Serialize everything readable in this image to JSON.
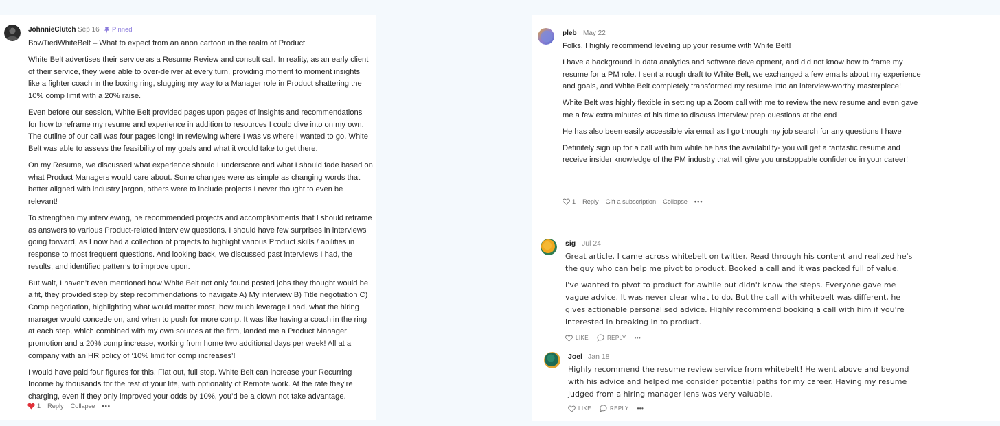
{
  "comments": {
    "johnnie": {
      "author": "JohnnieClutch",
      "date": "Sep 16",
      "pinned_label": "Pinned",
      "paragraphs": [
        "BowTiedWhiteBelt – What to expect from an anon cartoon in the realm of Product",
        "White Belt advertises their service as a Resume Review and consult call. In reality, as an early client of their service, they were able to over-deliver at every turn, providing moment to moment insights like a fighter coach in the boxing ring, slugging my way to a Manager role in Product shattering the 10% comp limit with a 20% raise.",
        "Even before our session, White Belt provided pages upon pages of insights and recommendations for how to reframe my resume and experience in addition to resources I could dive into on my own. The outline of our call was four pages long! In reviewing where I was vs where I wanted to go, White Belt was able to assess the feasibility of my goals and what it would take to get there.",
        "On my Resume, we discussed what experience should I underscore and what I should fade based on what Product Managers would care about. Some changes were as simple as changing words that better aligned with industry jargon, others were to include projects I never thought to even be relevant!",
        "To strengthen my interviewing, he recommended projects and accomplishments that I should reframe as answers to various Product-related interview questions. I should have few surprises in interviews going forward, as I now had a collection of projects to highlight various Product skills / abilities in response to most frequent questions. And looking back, we discussed past interviews I had, the results, and identified patterns to improve upon.",
        "But wait, I haven’t even mentioned how White Belt not only found posted jobs they thought would be a fit, they provided step by step recommendations to navigate A) My interview B) Title negotiation C) Comp negotiation, highlighting what would matter most, how much leverage I had, what the hiring manager would concede on, and when to push for more comp. It was like having a coach in the ring at each step, which combined with my own sources at the firm, landed me a Product Manager promotion and a 20% comp increase, working from home two additional days per week! All at a company with an HR policy of ‘10% limit for comp increases’!",
        "I would have paid four figures for this. Flat out, full stop. White Belt can increase your Recurring Income by thousands for the rest of your life, with optionality of Remote work. At the rate they’re charging, even if they only improved your odds by 10%, you’d be a clown not take advantage."
      ],
      "like_count": "1",
      "reply_label": "Reply",
      "collapse_label": "Collapse",
      "more": "•••"
    },
    "pleb": {
      "author": "pleb",
      "date": "May 22",
      "paragraphs": [
        "Folks, I highly recommend leveling up your resume with White Belt!",
        "I have a background in data analytics and software development, and did not know how to frame my resume for a PM role. I sent a rough draft to White Belt, we exchanged a few emails about my experience and goals, and White Belt completely transformed my resume into an interview-worthy masterpiece!",
        "White Belt was highly flexible in setting up a Zoom call with me to review the new resume and even gave me a few extra minutes of his time to discuss interview prep questions at the end",
        "He has also been easily accessible via email as I go through my job search for any questions I have",
        "Definitely sign up for a call with him while he has the availability- you will get a fantastic resume and receive insider knowledge of the PM industry that will give you unstoppable confidence in your career!"
      ],
      "like_count": "1",
      "reply_label": "Reply",
      "gift_label": "Gift a subscription",
      "collapse_label": "Collapse",
      "more": "•••"
    },
    "sig": {
      "author": "sig",
      "date": "Jul 24",
      "paragraphs": [
        "Great article. I came across whitebelt on twitter. Read through his content and realized he's the guy who can help me pivot to product. Booked a call and it was packed full of value.",
        "I've wanted to pivot to product for awhile but didn't know the steps. Everyone gave me vague advice. It was never clear what to do. But the call with whitebelt was different, he gives actionable personalised advice. Highly recommend booking a call with him if you're interested in breaking in to product."
      ],
      "like_label": "LIKE",
      "reply_label": "REPLY",
      "more": "•••"
    },
    "joel": {
      "author": "Joel",
      "date": "Jan 18",
      "paragraphs": [
        "Highly recommend the resume review service from whitebelt! He went above and beyond with his advice and helped me consider potential paths for my career. Having my resume judged from a hiring manager lens was very valuable."
      ],
      "like_label": "LIKE",
      "reply_label": "REPLY",
      "more": "•••"
    }
  },
  "colors": {
    "pinned": "#8b7bdc",
    "heart_liked": "#e0313a",
    "muted": "#6b6b6b"
  }
}
